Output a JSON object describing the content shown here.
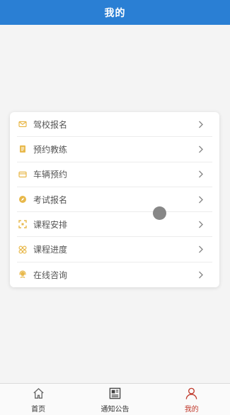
{
  "header": {
    "title": "我的"
  },
  "colors": {
    "header_bg": "#2a7fd4",
    "icon_accent": "#e8b84a",
    "tab_active": "#c0392b"
  },
  "menu": {
    "items": [
      {
        "label": "驾校报名",
        "icon": "envelope-icon"
      },
      {
        "label": "预约教练",
        "icon": "document-icon"
      },
      {
        "label": "车辆预约",
        "icon": "card-icon"
      },
      {
        "label": "考试报名",
        "icon": "compass-icon"
      },
      {
        "label": "课程安排",
        "icon": "expand-icon"
      },
      {
        "label": "课程进度",
        "icon": "grid-icon"
      },
      {
        "label": "在线咨询",
        "icon": "headset-icon"
      }
    ]
  },
  "tabbar": {
    "tabs": [
      {
        "label": "首页",
        "icon": "home-icon",
        "active": false
      },
      {
        "label": "通知公告",
        "icon": "newspaper-icon",
        "active": false
      },
      {
        "label": "我的",
        "icon": "user-icon",
        "active": true
      }
    ]
  }
}
